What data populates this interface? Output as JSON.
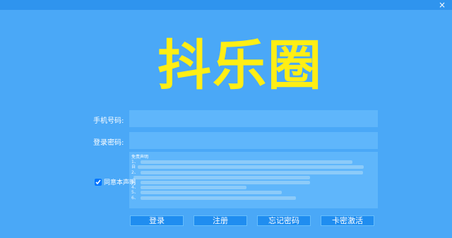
{
  "window": {
    "close_glyph": "×"
  },
  "logo": {
    "text": "抖乐圈",
    "color": "#ffee14"
  },
  "form": {
    "phone_label": "手机号码:",
    "password_label": "登录密码:",
    "phone_value": "",
    "password_value": ""
  },
  "disclaimer": {
    "title": "免责声明",
    "lines": [
      "1、",
      "自",
      "2、",
      "3、",
      "4、",
      "5、",
      "6、"
    ]
  },
  "agree": {
    "label": "同意本声明",
    "checked": true
  },
  "buttons": {
    "login": "登录",
    "register": "注册",
    "forgot": "忘记密码",
    "activate": "卡密激活"
  },
  "colors": {
    "background": "#4aa8f7",
    "field": "#5fb6fb",
    "button": "#1f8df0"
  }
}
